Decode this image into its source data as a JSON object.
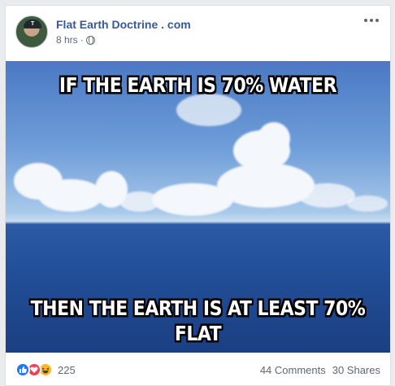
{
  "post": {
    "page_name": "Flat Earth Doctrine . com",
    "time": "8 hrs",
    "separator": "·",
    "avatar_cap_letter": "T"
  },
  "image": {
    "top_text": "IF THE EARTH IS 70% WATER",
    "bottom_text_line1": "THEN THE EARTH IS AT LEAST 70%",
    "bottom_text_line2": "FLAT"
  },
  "footer": {
    "reactions": [
      "like-icon",
      "love-icon",
      "haha-icon"
    ],
    "reaction_count": "225",
    "comments": "44 Comments",
    "shares": "30 Shares"
  },
  "colors": {
    "link_blue": "#385898",
    "like": "#2078f4",
    "love": "#f33e58",
    "haha": "#f7b928"
  }
}
